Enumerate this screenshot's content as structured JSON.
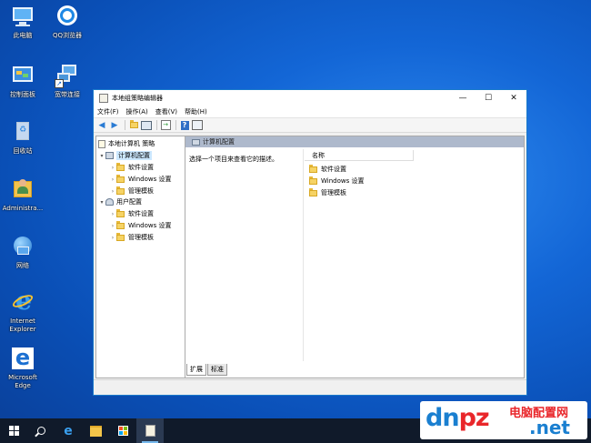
{
  "desktop": {
    "icons": [
      {
        "label": "此电脑",
        "icon": "computer-icon"
      },
      {
        "label": "QQ浏览器",
        "icon": "qq-browser-icon"
      },
      {
        "label": "控制面板",
        "icon": "control-panel-icon"
      },
      {
        "label": "宽带连接",
        "icon": "broadband-icon"
      },
      {
        "label": "回收站",
        "icon": "recycle-bin-icon"
      },
      {
        "label": "Administra...",
        "icon": "user-folder-icon"
      },
      {
        "label": "网络",
        "icon": "network-icon"
      },
      {
        "label": "Internet Explorer",
        "icon": "ie-icon"
      },
      {
        "label": "Microsoft Edge",
        "icon": "edge-icon"
      }
    ]
  },
  "window": {
    "title": "本地组策略编辑器",
    "menu": [
      "文件(F)",
      "操作(A)",
      "查看(V)",
      "帮助(H)"
    ],
    "tree": {
      "root": "本地计算机 策略",
      "computer_config": "计算机配置",
      "computer_children": [
        "软件设置",
        "Windows 设置",
        "管理模板"
      ],
      "user_config": "用户配置",
      "user_children": [
        "软件设置",
        "Windows 设置",
        "管理模板"
      ]
    },
    "right": {
      "header": "计算机配置",
      "description": "选择一个项目来查看它的描述。",
      "column_name": "名称",
      "items": [
        "软件设置",
        "Windows 设置",
        "管理模板"
      ]
    },
    "tabs": [
      "扩展",
      "标准"
    ]
  },
  "watermark": {
    "dn": "dn",
    "pz": "pz",
    "cn": "电脑配置网",
    "net": ".net"
  },
  "colors": {
    "accent": "#1979ca",
    "selected": "#cce8ff",
    "header": "#aeb9cc"
  }
}
